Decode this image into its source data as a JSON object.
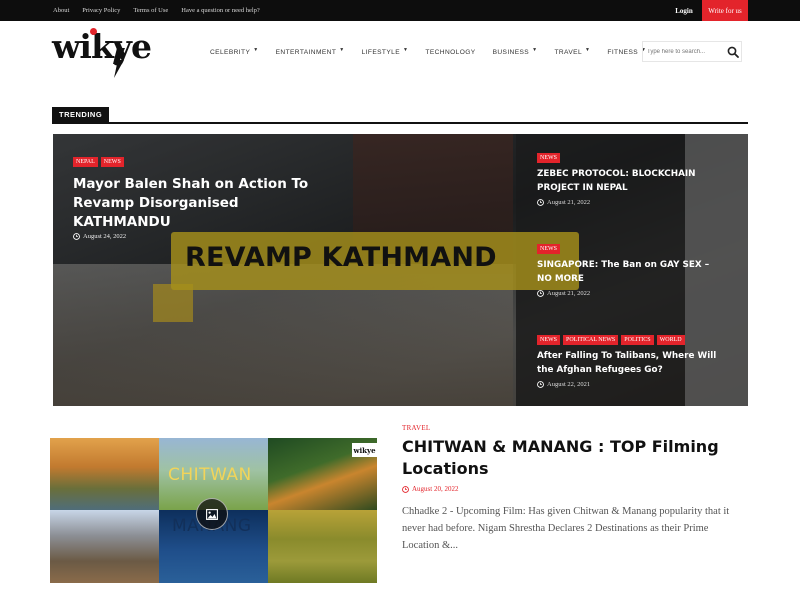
{
  "topbar": {
    "links": [
      "About",
      "Privacy Policy",
      "Terms of Use",
      "Have a question or need help?"
    ],
    "login_label": "Login",
    "write_label": "Write for us"
  },
  "brand": {
    "logo_text": "wikye",
    "accent_color": "#e3242b"
  },
  "nav": {
    "items": [
      {
        "label": "CELEBRITY",
        "has_dropdown": true
      },
      {
        "label": "ENTERTAINMENT",
        "has_dropdown": true
      },
      {
        "label": "LIFESTYLE",
        "has_dropdown": true
      },
      {
        "label": "TECHNOLOGY",
        "has_dropdown": false
      },
      {
        "label": "BUSINESS",
        "has_dropdown": true
      },
      {
        "label": "TRAVEL",
        "has_dropdown": true
      },
      {
        "label": "FITNESS",
        "has_dropdown": true
      }
    ],
    "search_placeholder": "Type here to search...",
    "search_icon": "search-icon"
  },
  "trending": {
    "label": "TRENDING",
    "banner_text": "REVAMP KATHMAND",
    "lead": {
      "tags": [
        "NEPAL",
        "NEWS"
      ],
      "title": "Mayor Balen Shah on Action To Revamp Disorganised KATHMANDU",
      "date": "August 24, 2022"
    },
    "side": [
      {
        "tags": [
          "NEWS"
        ],
        "title": "ZEBEC PROTOCOL: BLOCKCHAIN PROJECT IN NEPAL",
        "date": "August 21, 2022"
      },
      {
        "tags": [
          "NEWS"
        ],
        "title": "SINGAPORE: The Ban on GAY SEX – NO MORE",
        "date": "August 21, 2022"
      },
      {
        "tags": [
          "NEWS",
          "POLITICAL NEWS",
          "POLITICS",
          "WORLD"
        ],
        "title": "After Falling To Talibans, Where Will the Afghan Refugees Go?",
        "date": "August 22, 2021"
      }
    ]
  },
  "article": {
    "category": "TRAVEL",
    "title": "CHITWAN & MANANG : TOP Filming Locations",
    "date": "August 20, 2022",
    "excerpt": "Chhadke 2 - Upcoming Film: Has given Chitwan & Manang popularity that it never had before. Nigam Shrestha Declares 2 Destinations as their Prime Location &...",
    "thumb_word_1": "CHITWAN",
    "thumb_word_2": "MANANG",
    "thumb_logo": "wikye",
    "thumb_icon": "image-icon"
  }
}
